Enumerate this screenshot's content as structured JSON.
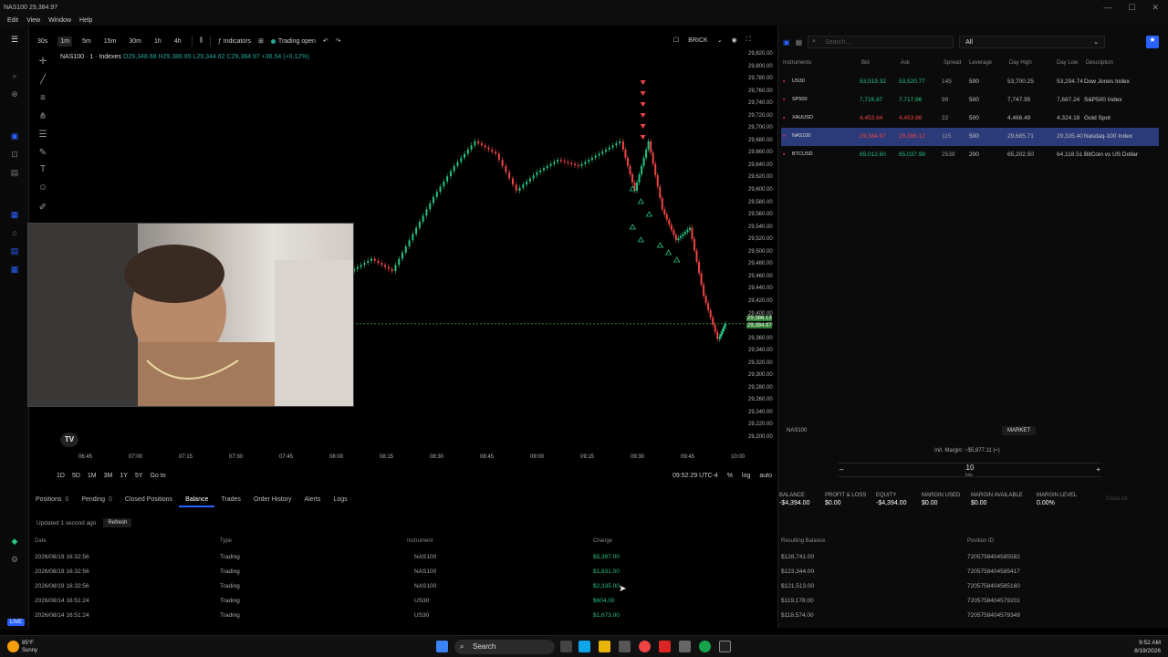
{
  "window": {
    "title": "NAS100 29,384.97",
    "menu": [
      "Edit",
      "View",
      "Window",
      "Help"
    ]
  },
  "toolbar": {
    "timeframes": [
      "30s",
      "1m",
      "5m",
      "15m",
      "30m",
      "1h",
      "4h"
    ],
    "active_timeframe": "1m",
    "indicators_label": "Indicators",
    "trading_label": "Trading open",
    "chart_style": "BRICK"
  },
  "legend": {
    "symbol": "NAS100 · 1 · Indexes",
    "ohlc": "O29,348.68 H29,386.65 L29,344.62 C29,384.97 +36.54 (+0.12%)"
  },
  "chart_data": {
    "type": "candlestick",
    "x_ticks": [
      "06:45",
      "07:00",
      "07:15",
      "07:30",
      "07:45",
      "08:00",
      "08:15",
      "08:30",
      "08:45",
      "09:00",
      "09:15",
      "09:30",
      "09:45",
      "10:00"
    ],
    "y_ticks": [
      29820,
      29800,
      29780,
      29760,
      29740,
      29720,
      29700,
      29680,
      29660,
      29640,
      29620,
      29600,
      29580,
      29560,
      29540,
      29520,
      29500,
      29480,
      29460,
      29440,
      29420,
      29400,
      29380,
      29360,
      29340,
      29320,
      29300,
      29280,
      29260,
      29240,
      29220,
      29200
    ],
    "y_tick_labels": [
      "29,820.00",
      "29,800.00",
      "29,780.00",
      "29,760.00",
      "29,740.00",
      "29,720.00",
      "29,700.00",
      "29,680.00",
      "29,660.00",
      "29,640.00",
      "29,620.00",
      "29,600.00",
      "29,580.00",
      "29,560.00",
      "29,540.00",
      "29,520.00",
      "29,500.00",
      "29,480.00",
      "29,460.00",
      "29,440.00",
      "29,420.00",
      "29,400.00",
      "29,380.00",
      "29,360.00",
      "29,340.00",
      "29,320.00",
      "29,300.00",
      "29,280.00",
      "29,260.00",
      "29,240.00",
      "29,220.00",
      "29,200.00"
    ],
    "ylim": [
      29200,
      29820
    ],
    "last_price_tags": [
      "29,386.13",
      "29,384.97"
    ],
    "price_line": 29384.97,
    "series": [
      {
        "t": 0.43,
        "c": 29470
      },
      {
        "t": 0.46,
        "c": 29490
      },
      {
        "t": 0.49,
        "c": 29470
      },
      {
        "t": 0.52,
        "c": 29530
      },
      {
        "t": 0.55,
        "c": 29590
      },
      {
        "t": 0.58,
        "c": 29640
      },
      {
        "t": 0.61,
        "c": 29680
      },
      {
        "t": 0.64,
        "c": 29660
      },
      {
        "t": 0.67,
        "c": 29600
      },
      {
        "t": 0.7,
        "c": 29630
      },
      {
        "t": 0.73,
        "c": 29650
      },
      {
        "t": 0.76,
        "c": 29640
      },
      {
        "t": 0.79,
        "c": 29660
      },
      {
        "t": 0.82,
        "c": 29680
      },
      {
        "t": 0.84,
        "c": 29600
      },
      {
        "t": 0.86,
        "c": 29680
      },
      {
        "t": 0.88,
        "c": 29570
      },
      {
        "t": 0.9,
        "c": 29520
      },
      {
        "t": 0.92,
        "c": 29540
      },
      {
        "t": 0.94,
        "c": 29430
      },
      {
        "t": 0.96,
        "c": 29360
      },
      {
        "t": 0.97,
        "c": 29385
      }
    ]
  },
  "time_axis_extra": {
    "clock": "09:52:29 UTC-4",
    "pct": "%",
    "log": "log",
    "auto": "auto"
  },
  "range_buttons": [
    "1D",
    "5D",
    "1M",
    "3M",
    "1Y",
    "5Y",
    "Go to"
  ],
  "instruments_panel": {
    "search_placeholder": "Search...",
    "filter": "All",
    "columns": [
      "Instruments",
      "Bid",
      "Ask",
      "Spread",
      "Leverage",
      "Day High",
      "Day Low",
      "Description"
    ],
    "rows": [
      {
        "sym": "US30",
        "bid": "53,519.32",
        "ask": "53,520.77",
        "spread": "145",
        "lev": "500",
        "high": "53,700.25",
        "low": "53,294.74",
        "desc": "Dow Jones Index",
        "dir": "up"
      },
      {
        "sym": "SP500",
        "bid": "7,716.87",
        "ask": "7,717.86",
        "spread": "99",
        "lev": "500",
        "high": "7,747.95",
        "low": "7,687.24",
        "desc": "S&P500 Index",
        "dir": "up"
      },
      {
        "sym": "XAUUSD",
        "bid": "4,453.64",
        "ask": "4,453.86",
        "spread": "22",
        "lev": "500",
        "high": "4,466.49",
        "low": "4,324.18",
        "desc": "Gold Spot",
        "dir": "dn"
      },
      {
        "sym": "NAS100",
        "bid": "29,384.97",
        "ask": "29,386.12",
        "spread": "115",
        "lev": "500",
        "high": "29,685.71",
        "low": "29,335.40",
        "desc": "Nasdaq-100 Index",
        "dir": "dn"
      },
      {
        "sym": "BTCUSD",
        "bid": "65,012.60",
        "ask": "65,037.99",
        "spread": "2539",
        "lev": "200",
        "high": "65,202.50",
        "low": "64,118.51",
        "desc": "BitCoin vs US Dollar",
        "dir": "up"
      }
    ],
    "selected_index": 3
  },
  "order": {
    "symbol": "NAS100",
    "type": "MARKET",
    "init_margin": "Init. Margin: ~$5,877.11 (≈)",
    "qty": "10",
    "qty_unit": "lots",
    "minus": "–",
    "plus": "+"
  },
  "account": {
    "balance_label": "BALANCE",
    "balance": "-$4,394.00",
    "pl_label": "PROFIT & LOSS",
    "pl": "$0.00",
    "equity_label": "EQUITY",
    "equity": "-$4,394.00",
    "margin_used_label": "MARGIN USED",
    "margin_used": "$0.00",
    "margin_avail_label": "MARGIN AVAILABLE",
    "margin_avail": "$0.00",
    "margin_level_label": "MARGIN LEVEL",
    "margin_level": "0.00%",
    "close_all": "Close All"
  },
  "tabs": [
    {
      "label": "Positions",
      "count": "0"
    },
    {
      "label": "Pending",
      "count": "0"
    },
    {
      "label": "Closed Positions",
      "count": ""
    },
    {
      "label": "Balance",
      "count": ""
    },
    {
      "label": "Trades",
      "count": ""
    },
    {
      "label": "Order History",
      "count": ""
    },
    {
      "label": "Alerts",
      "count": ""
    },
    {
      "label": "Logs",
      "count": ""
    }
  ],
  "active_tab": "Balance",
  "updated": {
    "text": "Updated 1 second ago",
    "refresh": "Refresh"
  },
  "balance_table": {
    "columns": [
      "Date",
      "Type",
      "Instrument",
      "Change",
      "Resulting Balance",
      "Position ID"
    ],
    "rows": [
      {
        "date": "2026/08/19 16:32:56",
        "type": "Trading",
        "inst": "NAS100",
        "change": "$5,397.00",
        "result": "$128,741.00",
        "pid": "7205758404585582"
      },
      {
        "date": "2026/08/19 16:32:56",
        "type": "Trading",
        "inst": "NAS100",
        "change": "$1,831.00",
        "result": "$123,344.00",
        "pid": "7205758404585417"
      },
      {
        "date": "2026/08/19 16:32:56",
        "type": "Trading",
        "inst": "NAS100",
        "change": "$2,335.00",
        "result": "$121,513.00",
        "pid": "7205758404585160"
      },
      {
        "date": "2026/08/14 16:51:24",
        "type": "Trading",
        "inst": "US30",
        "change": "$604.00",
        "result": "$119,178.00",
        "pid": "7205758404579201"
      },
      {
        "date": "2026/08/14 16:51:24",
        "type": "Trading",
        "inst": "US30",
        "change": "$1,673.00",
        "result": "$118,574.00",
        "pid": "7205758404579349"
      }
    ]
  },
  "taskbar": {
    "search": "Search",
    "weather_temp": "85°F",
    "weather_cond": "Sunny",
    "time": "9:52 AM",
    "date": "8/19/2026",
    "live": "LIVE"
  },
  "colors": {
    "up": "#26c281",
    "down": "#ef4444",
    "accent": "#2962ff",
    "selected_row": "#2b3a78"
  }
}
